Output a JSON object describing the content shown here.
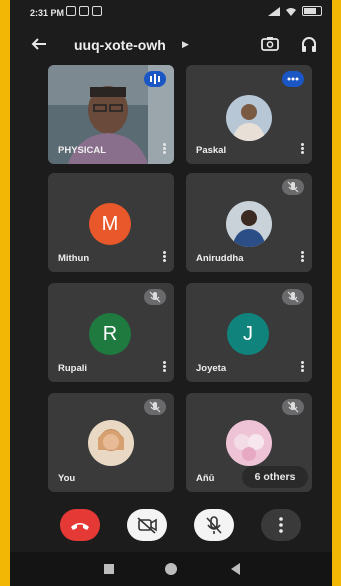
{
  "status_bar": {
    "time": "2:31 PM"
  },
  "header": {
    "title": "uuq-xote-owh"
  },
  "tiles": [
    {
      "name": "PHYSICAL"
    },
    {
      "name": "Paskal"
    },
    {
      "name": "Mithun",
      "initial": "M",
      "color": "#e8582a"
    },
    {
      "name": "Aniruddha"
    },
    {
      "name": "Rupali",
      "initial": "R",
      "color": "#1f7a3f"
    },
    {
      "name": "Joyeta",
      "initial": "J",
      "color": "#11837d"
    },
    {
      "name": "You"
    },
    {
      "name": "Añū"
    }
  ],
  "others_chip": {
    "label": "6 others"
  },
  "colors": {
    "end_call": "#e53935",
    "speaking_indicator": "#1a56c4",
    "tile_bg": "#3a3a3b",
    "screen_bg": "#1c1c1c"
  }
}
